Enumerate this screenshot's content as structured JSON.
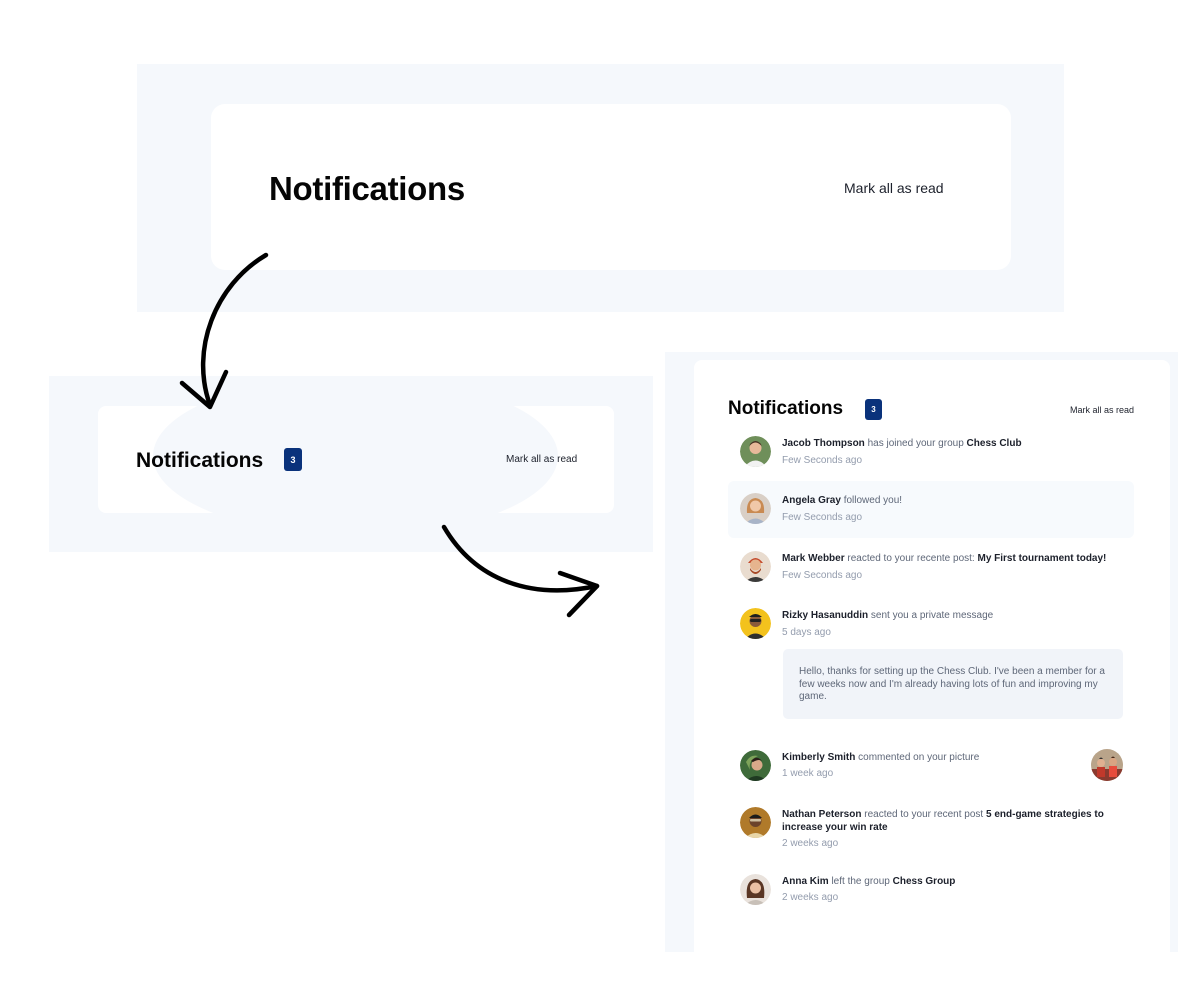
{
  "panel1": {
    "title": "Notifications",
    "mark_all": "Mark all as read"
  },
  "panel2": {
    "title": "Notifications",
    "badge": "3",
    "mark_all": "Mark all as read"
  },
  "panel3": {
    "title": "Notifications",
    "badge": "3",
    "mark_all": "Mark all as read",
    "accent_color": "#0a327b",
    "notifications": [
      {
        "user": "Jacob Thompson",
        "action": "has joined your group",
        "object": "Chess Club",
        "time": "Few Seconds ago",
        "unread": false
      },
      {
        "user": "Angela Gray",
        "action": "followed you!",
        "object": "",
        "time": "Few Seconds ago",
        "unread": true
      },
      {
        "user": "Mark Webber",
        "action": "reacted to your recente post:",
        "object": "My First tournament today!",
        "time": "Few Seconds ago",
        "unread": false
      },
      {
        "user": "Rizky Hasanuddin",
        "action": "sent you a private message",
        "object": "",
        "time": "5 days ago",
        "unread": false,
        "message": "Hello, thanks for setting up the Chess Club. I've been a member for a few weeks now and I'm already having lots of fun and improving my game."
      },
      {
        "user": "Kimberly Smith",
        "action": "commented on your picture",
        "object": "",
        "time": "1 week ago",
        "unread": false
      },
      {
        "user": "Nathan Peterson",
        "action": "reacted to your recent post",
        "object": "5 end-game strategies to increase your win rate",
        "time": "2 weeks ago",
        "unread": false
      },
      {
        "user": "Anna Kim",
        "action": "left the group",
        "object": "Chess Group",
        "time": "2 weeks ago",
        "unread": false
      }
    ]
  }
}
